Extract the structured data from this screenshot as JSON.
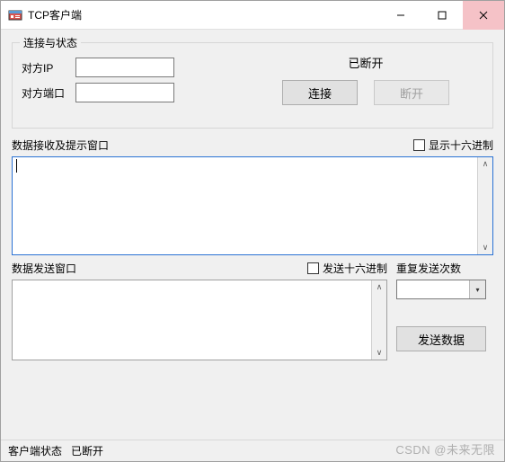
{
  "window": {
    "title": "TCP客户端"
  },
  "connection": {
    "legend": "连接与状态",
    "ip_label": "对方IP",
    "ip_value": "",
    "port_label": "对方端口",
    "port_value": "",
    "status_text": "已断开",
    "connect_btn": "连接",
    "disconnect_btn": "断开"
  },
  "receive": {
    "label": "数据接收及提示窗口",
    "hex_checkbox": "显示十六进制",
    "content": ""
  },
  "send": {
    "label": "数据发送窗口",
    "hex_checkbox": "发送十六进制",
    "content": "",
    "repeat_label": "重复发送次数",
    "repeat_value": "",
    "send_btn": "发送数据"
  },
  "statusbar": {
    "label": "客户端状态",
    "value": "已断开"
  },
  "watermark": "CSDN @未来无限"
}
